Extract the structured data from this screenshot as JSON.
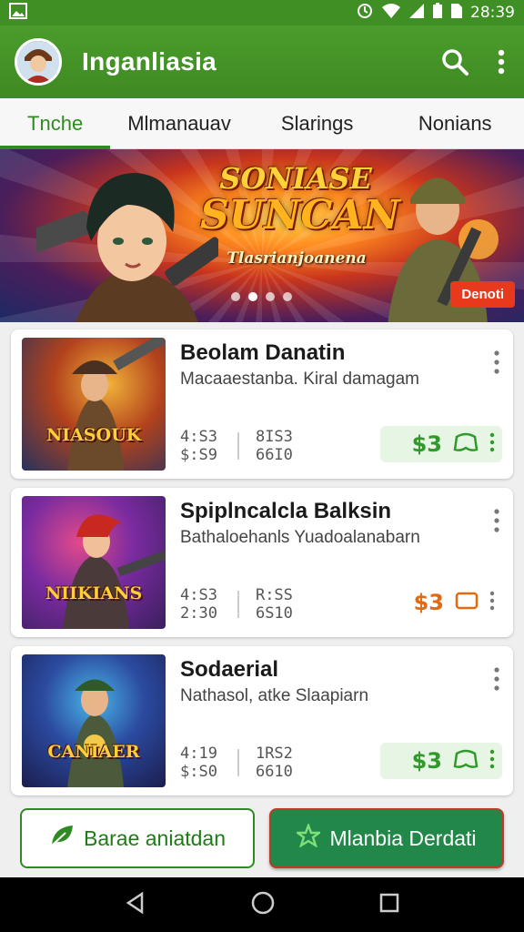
{
  "status_bar": {
    "time": "28:39"
  },
  "app_bar": {
    "title": "Inganliasia",
    "avatar_icon": "avatar-soldier",
    "search_icon": "search-icon",
    "more_icon": "more-vert-icon"
  },
  "tabs": [
    {
      "label": "Tnche",
      "active": true
    },
    {
      "label": "Mlmanauav",
      "active": false
    },
    {
      "label": "Slarings",
      "active": false
    },
    {
      "label": "Nonians",
      "active": false
    }
  ],
  "banner": {
    "title_line1": "SONIASE",
    "title_line2": "SUNCAN",
    "subtitle": "Tlasrianjoanena",
    "button_label": "Denoti",
    "pages": 4,
    "active_page": 1
  },
  "games": [
    {
      "title": "Beolam Danatin",
      "subtitle": "Macaaestanba. Kiral damagam",
      "thumb_caption": "NIASOUK",
      "stat1": [
        "4:S3",
        "$:S9"
      ],
      "stat2": [
        "8IS3",
        "66I0"
      ],
      "price": "$3",
      "price_style": "green",
      "thumb_colors": [
        "#f2b33a",
        "#b2421c",
        "#27325e"
      ]
    },
    {
      "title": "Spiplncalcla Balksin",
      "subtitle": "Bathaloehanls Yuadoalanabarn",
      "thumb_caption": "NIIKIANS",
      "stat1": [
        "4:S3",
        "2:30"
      ],
      "stat2": [
        "R:SS",
        "6S10"
      ],
      "price": "$3",
      "price_style": "orange",
      "thumb_colors": [
        "#e24a8a",
        "#7a2ba0",
        "#3a1f5e"
      ]
    },
    {
      "title": "Sodaerial",
      "subtitle": "Nathasol, atke Slaapiarn",
      "thumb_caption": "CANIAER",
      "stat1": [
        "4:19",
        "$:S0"
      ],
      "stat2": [
        "1RS2",
        "6610"
      ],
      "price": "$3",
      "price_style": "green",
      "thumb_colors": [
        "#4ab6e8",
        "#2b4aa0",
        "#1b1e4e"
      ]
    }
  ],
  "actions": {
    "secondary_label": "Barae aniatdan",
    "primary_label": "Mlanbia Derdati"
  },
  "colors": {
    "primary": "#3f8f25",
    "accent": "#21884a",
    "price_green": "#2f9a2a",
    "price_orange": "#e46a12"
  }
}
